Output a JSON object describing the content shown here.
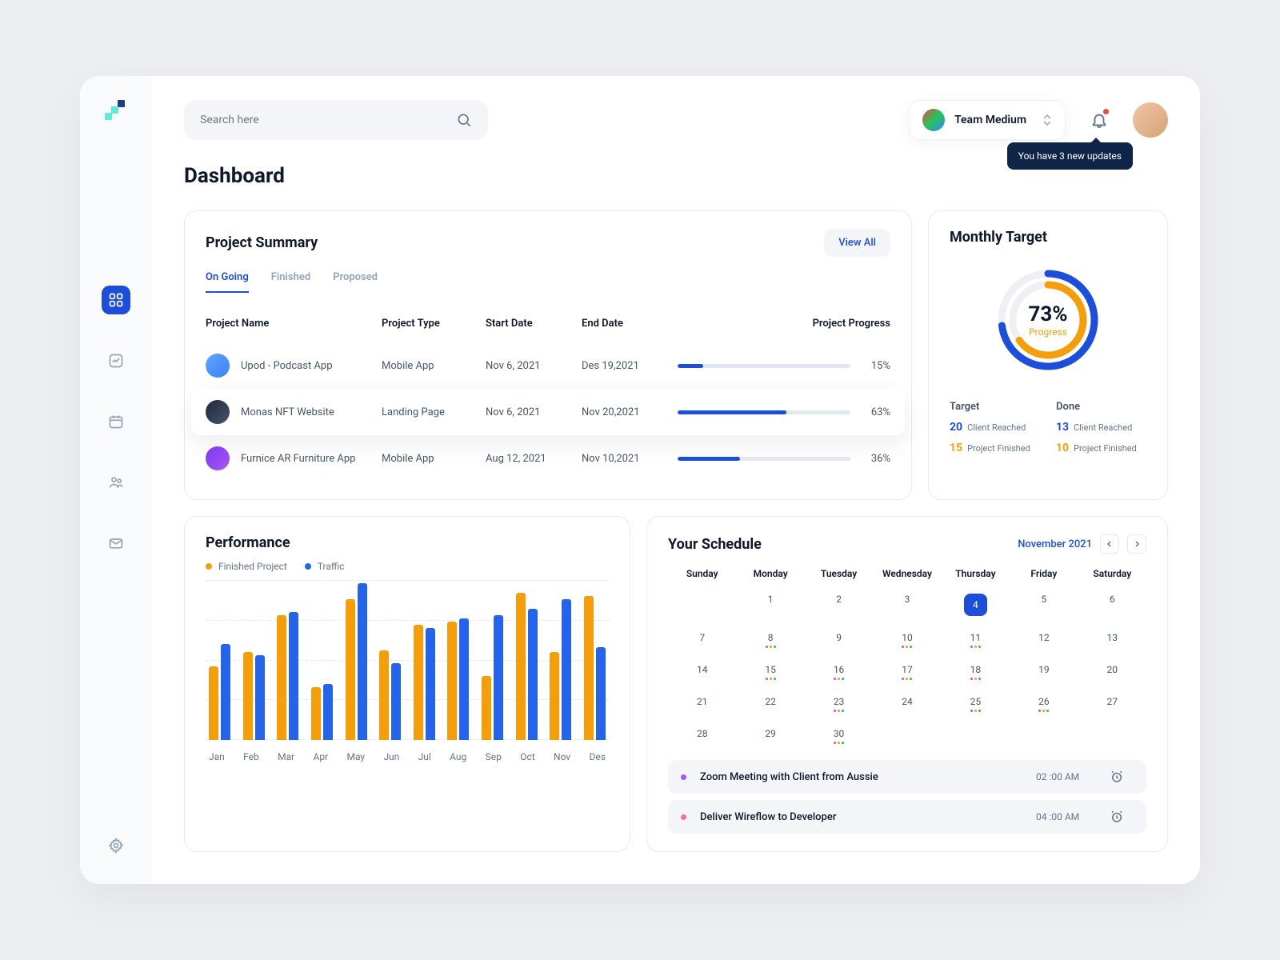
{
  "search": {
    "placeholder": "Search here"
  },
  "team": {
    "name": "Team Medium"
  },
  "notification": {
    "tooltip": "You have 3 new updates"
  },
  "page_title": "Dashboard",
  "project_summary": {
    "title": "Project Summary",
    "view_all": "View All",
    "tabs": [
      "On Going",
      "Finished",
      "Proposed"
    ],
    "columns": [
      "Project Name",
      "Project Type",
      "Start Date",
      "End Date",
      "Project Progress"
    ],
    "rows": [
      {
        "name": "Upod - Podcast App",
        "type": "Mobile App",
        "start": "Nov 6, 2021",
        "end": "Des 19,2021",
        "progress": 15,
        "pct": "15%"
      },
      {
        "name": "Monas NFT Website",
        "type": "Landing Page",
        "start": "Nov 6, 2021",
        "end": "Nov 20,2021",
        "progress": 63,
        "pct": "63%"
      },
      {
        "name": "Furnice AR  Furniture App",
        "type": "Mobile App",
        "start": "Aug 12, 2021",
        "end": "Nov 10,2021",
        "progress": 36,
        "pct": "36%"
      }
    ]
  },
  "monthly_target": {
    "title": "Monthly Target",
    "percent": "73%",
    "label": "Progress",
    "target_label": "Target",
    "done_label": "Done",
    "target": {
      "reached_num": "20",
      "reached_label": "Client Reached",
      "finished_num": "15",
      "finished_label": "Project Finished"
    },
    "done": {
      "reached_num": "13",
      "reached_label": "Client Reached",
      "finished_num": "10",
      "finished_label": "Project Finished"
    }
  },
  "performance": {
    "title": "Performance",
    "legend": {
      "finished": "Finished Project",
      "traffic": "Traffic"
    }
  },
  "schedule": {
    "title": "Your Schedule",
    "month": "November 2021",
    "days": [
      "Sunday",
      "Monday",
      "Tuesday",
      "Wednesday",
      "Thursday",
      "Friday",
      "Saturday"
    ],
    "events": [
      {
        "title": "Zoom Meeting with Client from Aussie",
        "time": "02 :00 AM"
      },
      {
        "title": "Deliver Wireflow to Developer",
        "time": "04 :00 AM"
      }
    ]
  },
  "chart_data": {
    "type": "bar",
    "categories": [
      "Jan",
      "Feb",
      "Mar",
      "Apr",
      "May",
      "Jun",
      "Jul",
      "Aug",
      "Sep",
      "Oct",
      "Nov",
      "Des"
    ],
    "series": [
      {
        "name": "Finished Project",
        "values": [
          46,
          55,
          78,
          33,
          88,
          56,
          72,
          74,
          40,
          92,
          55,
          90
        ]
      },
      {
        "name": "Traffic",
        "values": [
          60,
          53,
          80,
          35,
          98,
          48,
          70,
          76,
          78,
          82,
          88,
          58
        ]
      }
    ],
    "ylim": [
      0,
      100
    ],
    "ylabel": "",
    "xlabel": ""
  }
}
